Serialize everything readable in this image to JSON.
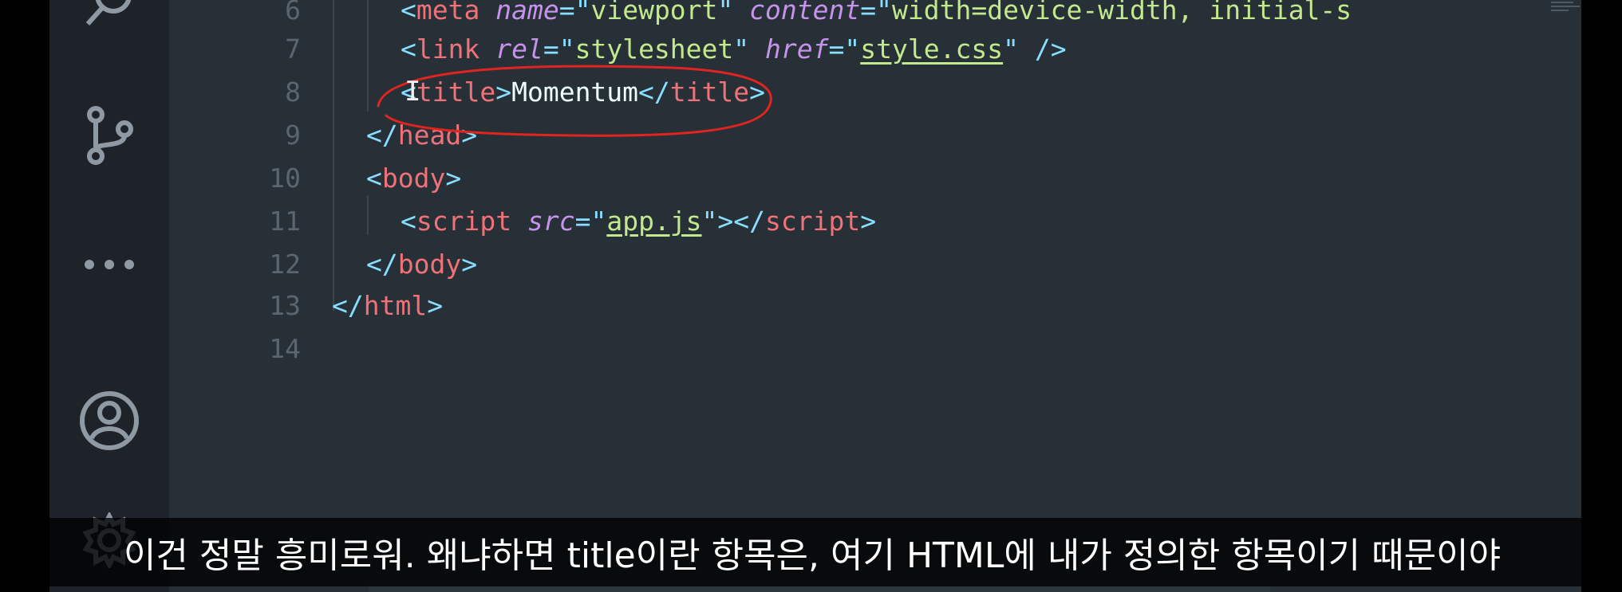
{
  "activity_bar": {
    "icons": [
      "search-icon",
      "source-control-icon",
      "more-icon",
      "account-icon",
      "settings-icon"
    ]
  },
  "editor": {
    "line_numbers": [
      "6",
      "7",
      "8",
      "9",
      "10",
      "11",
      "12",
      "13",
      "14"
    ],
    "line6": {
      "open": "<",
      "tag": "meta",
      "attr1": "name",
      "eq1": "=",
      "q1": "\"",
      "val1": "viewport",
      "q1b": "\"",
      "attr2": "content",
      "eq2": "=",
      "q2": "\"",
      "val2": "width=device-width, initial-s"
    },
    "line7": {
      "open": "<",
      "tag": "link",
      "attr1": "rel",
      "eq1": "=",
      "q1": "\"",
      "val1": "stylesheet",
      "q1b": "\"",
      "attr2": "href",
      "eq2": "=",
      "q2": "\"",
      "val2": "style.css",
      "q2b": "\"",
      "close": " />"
    },
    "line8": {
      "open": "<",
      "tag": "title",
      "close1": ">",
      "text": "Momentum",
      "open2": "</",
      "tag2": "title",
      "close2": ">"
    },
    "line9": {
      "open": "</",
      "tag": "head",
      "close": ">"
    },
    "line10": {
      "open": "<",
      "tag": "body",
      "close": ">"
    },
    "line11": {
      "open": "<",
      "tag": "script",
      "attr1": "src",
      "eq1": "=",
      "q1": "\"",
      "val1": "app.js",
      "q1b": "\"",
      "close1": "></",
      "tag2": "script",
      "close2": ">"
    },
    "line12": {
      "open": "</",
      "tag": "body",
      "close": ">"
    },
    "line13": {
      "open": "</",
      "tag": "html",
      "close": ">"
    }
  },
  "annotation": {
    "color": "#e0241f"
  },
  "subtitle": {
    "text": "이건 정말 흥미로워. 왜냐하면 title이란 항목은, 여기 HTML에 내가 정의한 항목이기 때문이야"
  },
  "colors": {
    "tag": "#f07178",
    "punctuation": "#89ddff",
    "attribute": "#c792ea",
    "string": "#c3e88d",
    "text": "#eeffff",
    "scroll_marker": "#e2a431"
  }
}
